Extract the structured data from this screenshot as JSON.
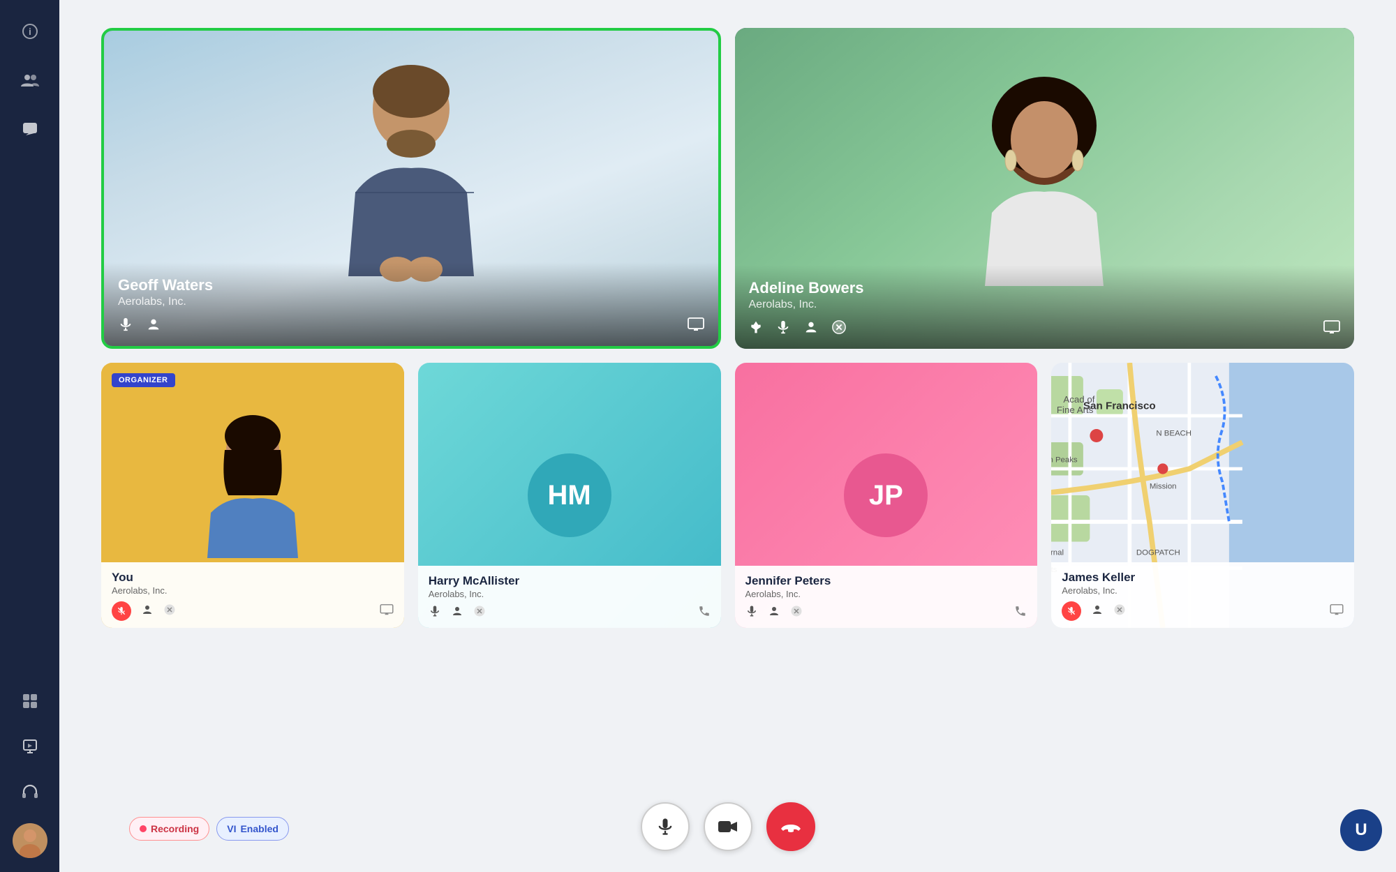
{
  "sidebar": {
    "icons": [
      {
        "name": "info-icon",
        "symbol": "ℹ",
        "interactable": true
      },
      {
        "name": "people-icon",
        "symbol": "👥",
        "interactable": true
      },
      {
        "name": "chat-icon",
        "symbol": "💬",
        "interactable": true
      },
      {
        "name": "grid-icon",
        "symbol": "⊞",
        "interactable": true
      },
      {
        "name": "share-icon",
        "symbol": "↗",
        "interactable": true
      },
      {
        "name": "headphones-icon",
        "symbol": "🎧",
        "interactable": true
      }
    ]
  },
  "participants": {
    "top_row": [
      {
        "id": "geoff",
        "name": "Geoff Waters",
        "org": "Aerolabs, Inc.",
        "active_speaker": true,
        "actions": [
          "mic",
          "person",
          "screen"
        ]
      },
      {
        "id": "adeline",
        "name": "Adeline Bowers",
        "org": "Aerolabs, Inc.",
        "active_speaker": false,
        "actions": [
          "pin",
          "mic",
          "person",
          "close",
          "screen"
        ]
      }
    ],
    "bottom_row": [
      {
        "id": "you",
        "name": "You",
        "org": "Aerolabs, Inc.",
        "is_organizer": true,
        "organizer_label": "ORGANIZER",
        "actions": [
          "mic_muted",
          "person",
          "close",
          "screen"
        ]
      },
      {
        "id": "harry",
        "name": "Harry McAllister",
        "org": "Aerolabs, Inc.",
        "initials": "HM",
        "actions": [
          "mic",
          "person",
          "close",
          "phone"
        ]
      },
      {
        "id": "jennifer",
        "name": "Jennifer Peters",
        "org": "Aerolabs, Inc.",
        "initials": "JP",
        "actions": [
          "mic",
          "person",
          "close",
          "phone"
        ]
      },
      {
        "id": "james",
        "name": "James Keller",
        "org": "Aerolabs, Inc.",
        "show_map": true,
        "actions": [
          "mic_muted",
          "person",
          "close",
          "screen"
        ]
      }
    ]
  },
  "toolbar": {
    "mic_label": "🎤",
    "video_label": "📷",
    "end_label": "📞"
  },
  "status_badges": {
    "recording_dot": "●",
    "recording_label": "Recording",
    "vi_label": "VI",
    "enabled_label": "Enabled"
  },
  "top_right": {
    "user_initial": "U"
  },
  "colors": {
    "active_speaker_border": "#22cc44",
    "sidebar_bg": "#1a2540",
    "end_call": "#e83040",
    "recording_dot": "#ff4466",
    "organizer_bg": "#3344cc"
  }
}
